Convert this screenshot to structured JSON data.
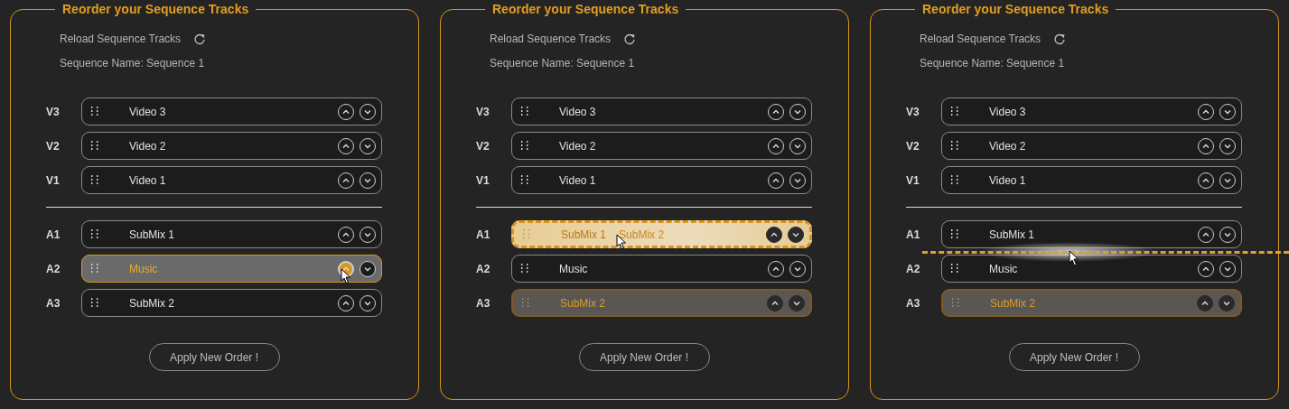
{
  "panels": [
    {
      "title": "Reorder your Sequence Tracks",
      "reload_label": "Reload Sequence Tracks",
      "sequence_name": "Sequence Name: Sequence 1",
      "video_tracks": [
        {
          "label": "V3",
          "name": "Video 3",
          "selected": false,
          "drop_target": false,
          "drag_source": false
        },
        {
          "label": "V2",
          "name": "Video 2",
          "selected": false,
          "drop_target": false,
          "drag_source": false
        },
        {
          "label": "V1",
          "name": "Video 1",
          "selected": false,
          "drop_target": false,
          "drag_source": false
        }
      ],
      "audio_tracks": [
        {
          "label": "A1",
          "name": "SubMix 1",
          "selected": false,
          "drop_target": false,
          "drag_source": false
        },
        {
          "label": "A2",
          "name": "Music",
          "selected": true,
          "drop_target": false,
          "drag_source": false,
          "cursor": true
        },
        {
          "label": "A3",
          "name": "SubMix 2",
          "selected": false,
          "drop_target": false,
          "drag_source": false
        }
      ],
      "apply_button": "Apply New Order !"
    },
    {
      "title": "Reorder your Sequence Tracks",
      "reload_label": "Reload Sequence Tracks",
      "sequence_name": "Sequence Name: Sequence 1",
      "video_tracks": [
        {
          "label": "V3",
          "name": "Video 3",
          "selected": false,
          "drop_target": false,
          "drag_source": false
        },
        {
          "label": "V2",
          "name": "Video 2",
          "selected": false,
          "drop_target": false,
          "drag_source": false
        },
        {
          "label": "V1",
          "name": "Video 1",
          "selected": false,
          "drop_target": false,
          "drag_source": false
        }
      ],
      "audio_tracks": [
        {
          "label": "A1",
          "name": "SubMix 1",
          "selected": false,
          "drop_target": true,
          "ghost_name": "SubMix 2",
          "drag_source": false,
          "cursor": true
        },
        {
          "label": "A2",
          "name": "Music",
          "selected": false,
          "drop_target": false,
          "drag_source": false
        },
        {
          "label": "A3",
          "name": "SubMix 2",
          "selected": false,
          "drop_target": false,
          "drag_source": true
        }
      ],
      "apply_button": "Apply New Order !"
    },
    {
      "title": "Reorder your Sequence Tracks",
      "reload_label": "Reload Sequence Tracks",
      "sequence_name": "Sequence Name: Sequence 1",
      "video_tracks": [
        {
          "label": "V3",
          "name": "Video 3",
          "selected": false,
          "drop_target": false,
          "drag_source": false
        },
        {
          "label": "V2",
          "name": "Video 2",
          "selected": false,
          "drop_target": false,
          "drag_source": false
        },
        {
          "label": "V1",
          "name": "Video 1",
          "selected": false,
          "drop_target": false,
          "drag_source": false
        }
      ],
      "audio_tracks": [
        {
          "label": "A1",
          "name": "SubMix 1",
          "selected": false,
          "drop_target": false,
          "drag_source": false,
          "insert_below": true,
          "cursor": true
        },
        {
          "label": "A2",
          "name": "Music",
          "selected": false,
          "drop_target": false,
          "drag_source": false
        },
        {
          "label": "A3",
          "name": "SubMix 2",
          "selected": false,
          "drop_target": false,
          "drag_source": true
        }
      ],
      "apply_button": "Apply New Order !"
    }
  ]
}
